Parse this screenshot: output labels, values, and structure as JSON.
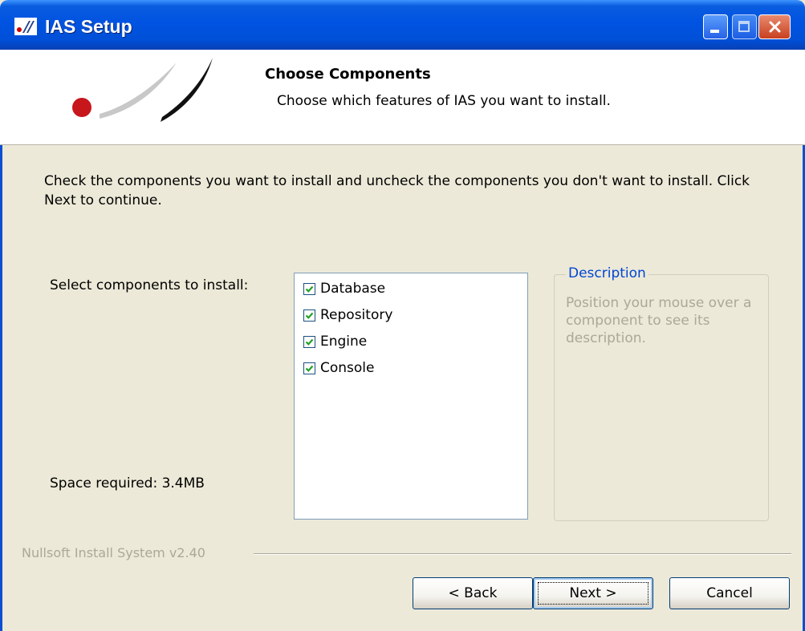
{
  "window": {
    "title": "IAS Setup",
    "colors": {
      "titlebar": "#0053e1",
      "dialog_bg": "#ece9d8",
      "accent": "#0046d5",
      "close": "#c8401f"
    }
  },
  "header": {
    "title": "Choose Components",
    "subtitle": "Choose which features of IAS you want to install."
  },
  "intro": "Check the components you want to install and uncheck the components you don't want to install. Click Next to continue.",
  "select_label": "Select components to install:",
  "components": [
    {
      "label": "Database",
      "checked": true
    },
    {
      "label": "Repository",
      "checked": true
    },
    {
      "label": "Engine",
      "checked": true
    },
    {
      "label": "Console",
      "checked": true
    }
  ],
  "space_required": "Space required: 3.4MB",
  "description": {
    "legend": "Description",
    "text": "Position your mouse over a component to see its description."
  },
  "branding": "Nullsoft Install System v2.40",
  "buttons": {
    "back": "< Back",
    "next": "Next >",
    "cancel": "Cancel"
  }
}
